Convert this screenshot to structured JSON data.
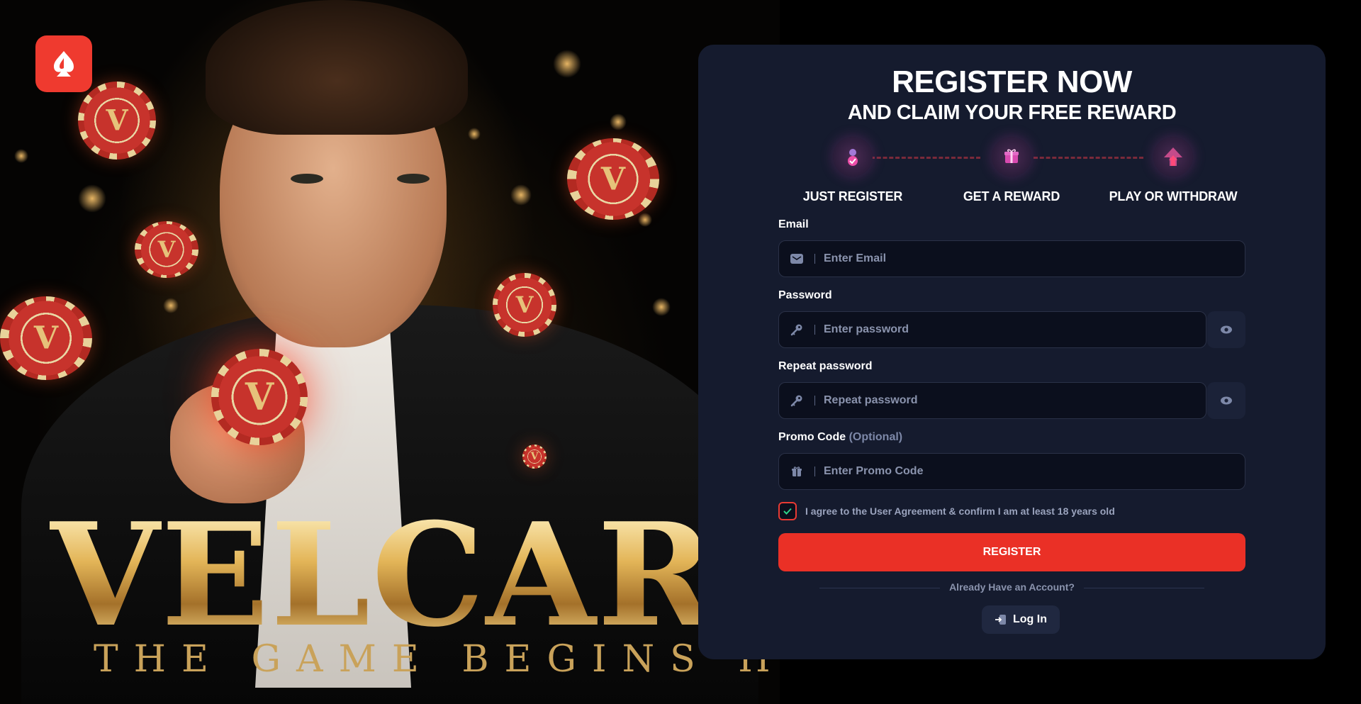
{
  "hero": {
    "brand": "VELCAR",
    "tagline": "THE GAME BEGINS HERE",
    "chip_letter": "V"
  },
  "logo": {
    "icon": "spade-flame-icon",
    "color": "#ef3a2f"
  },
  "register": {
    "title": "REGISTER NOW",
    "subtitle": "AND CLAIM YOUR FREE REWARD",
    "steps": [
      {
        "label": "JUST REGISTER",
        "icon": "user-check-icon"
      },
      {
        "label": "GET A REWARD",
        "icon": "gift-icon"
      },
      {
        "label": "PLAY OR WITHDRAW",
        "icon": "arrow-up-icon"
      }
    ],
    "email": {
      "label": "Email",
      "placeholder": "Enter Email",
      "icon": "envelope-icon"
    },
    "password": {
      "label": "Password",
      "placeholder": "Enter password",
      "icon": "key-icon"
    },
    "repeat_password": {
      "label": "Repeat password",
      "placeholder": "Repeat password",
      "icon": "key-icon"
    },
    "promo": {
      "label": "Promo Code",
      "optional": "(Optional)",
      "placeholder": "Enter Promo Code",
      "icon": "gift-icon"
    },
    "agree_text": "I agree to the User Agreement & confirm I am at least 18 years old",
    "register_button": "REGISTER",
    "already_text": "Already Have an Account?",
    "login_button": "Log In"
  },
  "colors": {
    "accent": "#ea3026",
    "panel_bg": "#151b2e",
    "input_bg": "#0b0f1d",
    "muted_text": "#8a93ad"
  }
}
